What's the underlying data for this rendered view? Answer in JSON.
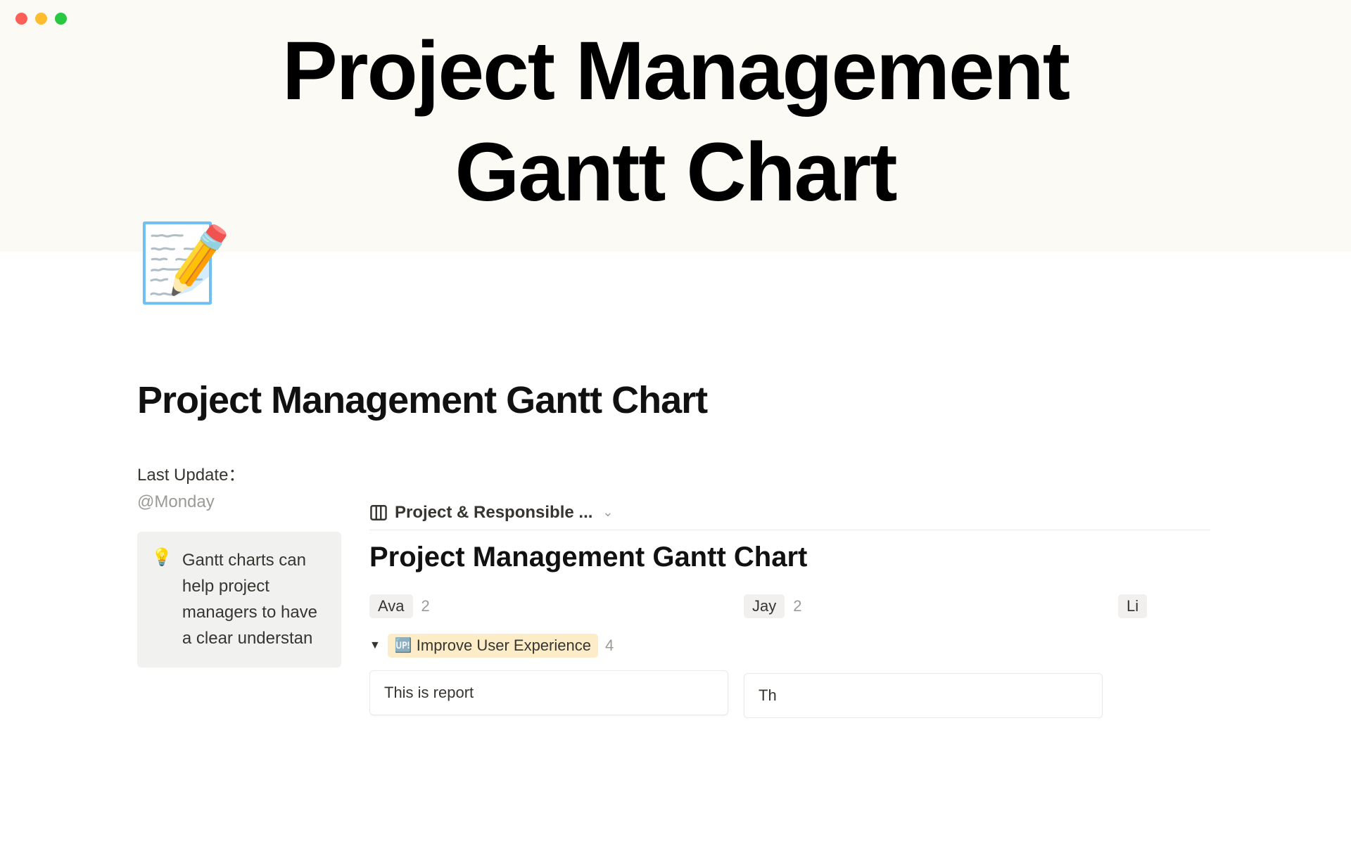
{
  "banner": {
    "title_line1": "Project Management",
    "title_line2": "Gantt Chart"
  },
  "page": {
    "icon": "📝",
    "title": "Project Management Gantt Chart"
  },
  "meta": {
    "label": "Last Update：",
    "value": "@Monday"
  },
  "callout": {
    "icon": "💡",
    "text": "Gantt charts can help project managers to have a clear understan"
  },
  "view": {
    "name": "Project & Responsible ..."
  },
  "database": {
    "title": "Project Management Gantt Chart",
    "groups": [
      {
        "name": "Ava",
        "count": "2"
      },
      {
        "name": "Jay",
        "count": "2"
      },
      {
        "name": "Li",
        "count": ""
      }
    ],
    "subgroup": {
      "emoji": "🆙",
      "label": "Improve User Experience",
      "count": "4"
    },
    "cards": [
      {
        "title": "This is report"
      },
      {
        "title": "Th"
      }
    ]
  }
}
